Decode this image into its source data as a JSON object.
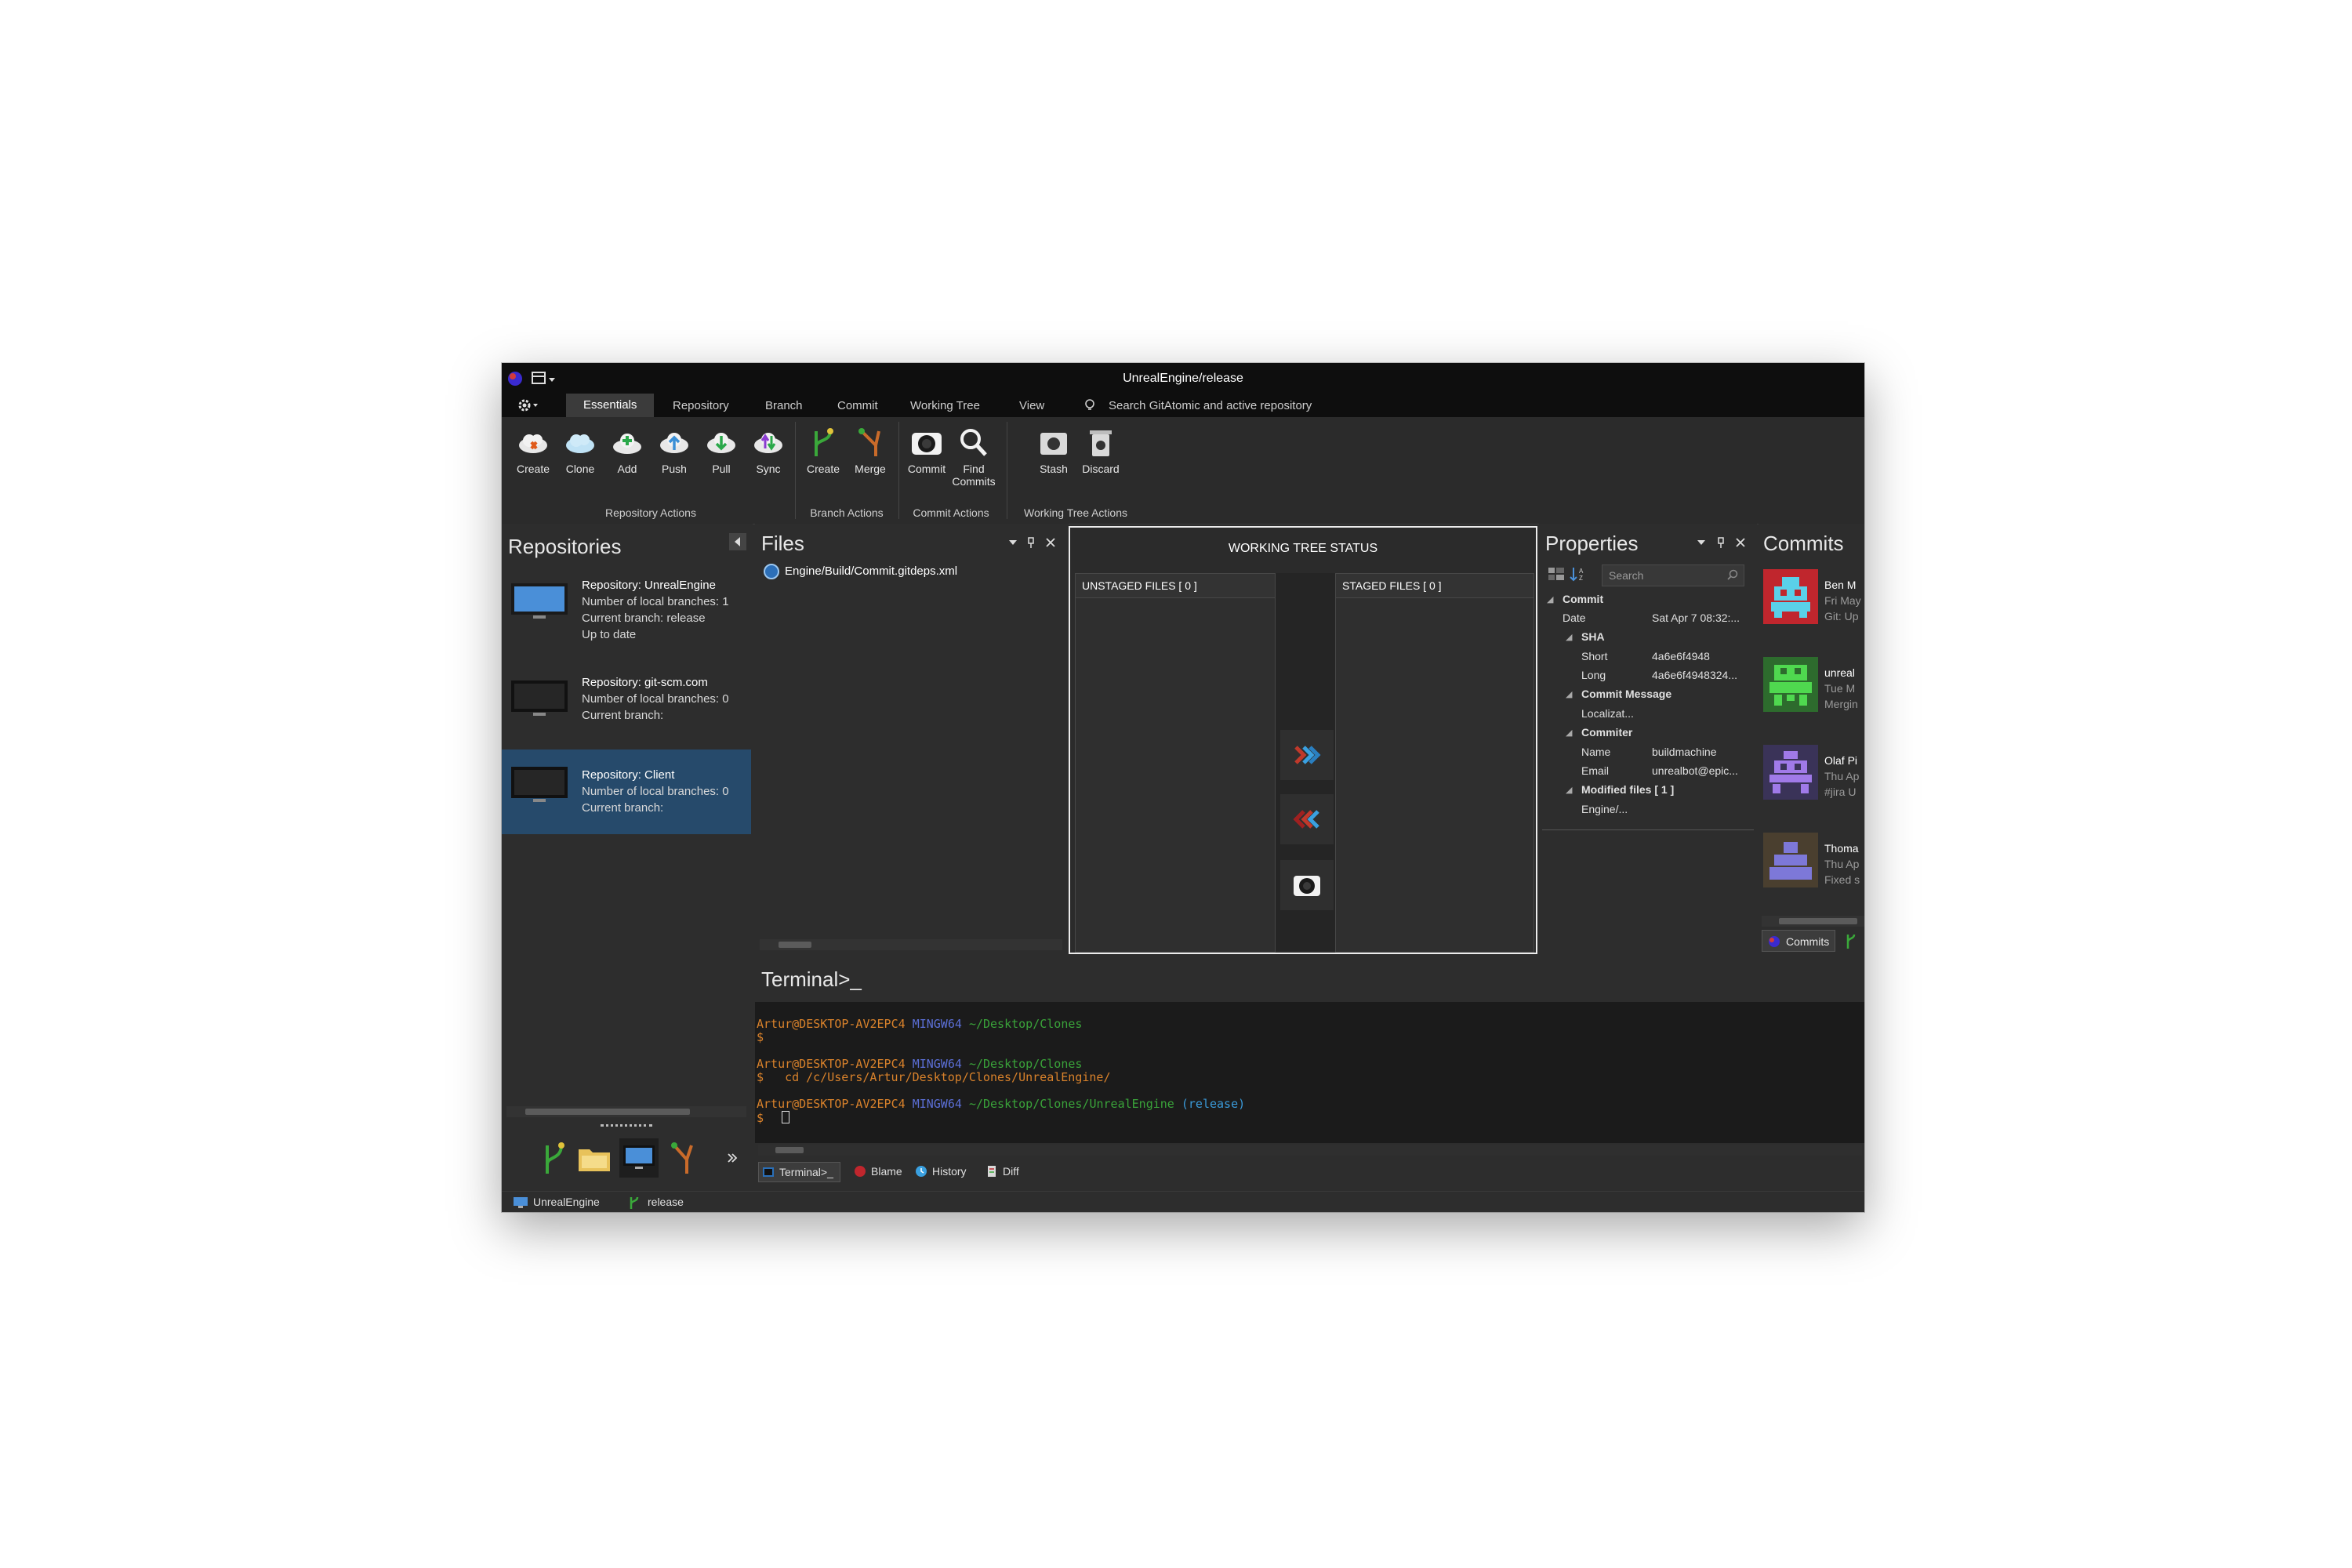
{
  "window": {
    "title": "UnrealEngine/release"
  },
  "menu": {
    "items": [
      "Essentials",
      "Repository",
      "Branch",
      "Commit",
      "Working Tree",
      "View"
    ],
    "search_hint": "Search GitAtomic and active repository"
  },
  "ribbon": {
    "repository_actions": {
      "label": "Repository Actions",
      "buttons": [
        "Create",
        "Clone",
        "Add",
        "Push",
        "Pull",
        "Sync"
      ]
    },
    "branch_actions": {
      "label": "Branch Actions",
      "buttons": [
        "Create",
        "Merge"
      ]
    },
    "commit_actions": {
      "label": "Commit Actions",
      "buttons": [
        "Commit",
        "Find Commits"
      ]
    },
    "working_tree_actions": {
      "label": "Working Tree Actions",
      "buttons": [
        "Stash",
        "Discard"
      ]
    }
  },
  "repositories": {
    "title": "Repositories",
    "items": [
      {
        "name": "Repository: UnrealEngine",
        "branches": "Number of local branches: 1",
        "current": "Current branch: release",
        "status": "Up to date"
      },
      {
        "name": "Repository: git-scm.com",
        "branches": "Number of local branches: 0",
        "current": "Current branch:",
        "status": ""
      },
      {
        "name": "Repository: Client",
        "branches": "Number of local branches: 0",
        "current": "Current branch:",
        "status": ""
      }
    ]
  },
  "files": {
    "title": "Files",
    "items": [
      "Engine/Build/Commit.gitdeps.xml"
    ]
  },
  "working_tree": {
    "title": "WORKING TREE STATUS",
    "unstaged": "UNSTAGED FILES [ 0 ]",
    "staged": "STAGED FILES [ 0 ]"
  },
  "properties": {
    "title": "Properties",
    "search_placeholder": "Search",
    "rows": {
      "commit": "Commit",
      "date_key": "Date",
      "date_val": "Sat Apr 7 08:32:...",
      "sha": "SHA",
      "short_key": "Short",
      "short_val": "4a6e6f4948",
      "long_key": "Long",
      "long_val": "4a6e6f4948324...",
      "msg": "Commit Message",
      "msg_val": "Localizat...",
      "commiter": "Commiter",
      "name_key": "Name",
      "name_val": "buildmachine",
      "email_key": "Email",
      "email_val": "unrealbot@epic...",
      "modified": "Modified files [ 1 ]",
      "modified_val": "Engine/..."
    }
  },
  "commits": {
    "title": "Commits",
    "items": [
      {
        "l1": "Ben M",
        "l2": "Fri May",
        "l3": "Git: Up",
        "color": "#c0262d"
      },
      {
        "l1": "unreal",
        "l2": "Tue M",
        "l3": "Mergin",
        "color": "#3cbf3c"
      },
      {
        "l1": "Olaf Pi",
        "l2": "Thu Ap",
        "l3": "#jira U",
        "color": "#8f5fd0"
      },
      {
        "l1": "Thoma",
        "l2": "Thu Ap",
        "l3": "Fixed s",
        "color": "#7d78d8"
      }
    ],
    "tab": "Commits"
  },
  "terminal": {
    "title": "Terminal>_",
    "lines": [
      {
        "user": "Artur@DESKTOP-AV2EPC4",
        "host": "MINGW64",
        "path": "~/Desktop/Clones",
        "branch": ""
      },
      {
        "prompt": "$",
        "cmd": ""
      },
      {
        "user": "Artur@DESKTOP-AV2EPC4",
        "host": "MINGW64",
        "path": "~/Desktop/Clones",
        "branch": ""
      },
      {
        "prompt": "$",
        "cmd": "cd /c/Users/Artur/Desktop/Clones/UnrealEngine/"
      },
      {
        "user": "Artur@DESKTOP-AV2EPC4",
        "host": "MINGW64",
        "path": "~/Desktop/Clones/UnrealEngine",
        "branch": "(release)"
      },
      {
        "prompt": "$",
        "cmd": ""
      }
    ],
    "tabs": [
      "Terminal>_",
      "Blame",
      "History",
      "Diff"
    ]
  },
  "statusbar": {
    "repo": "UnrealEngine",
    "branch": "release"
  },
  "colors": {
    "accent": "#264a6b",
    "term_user": "#d9822b",
    "term_host": "#5b6fd6",
    "term_path": "#3aa33a",
    "term_branch": "#3a9ad9"
  }
}
